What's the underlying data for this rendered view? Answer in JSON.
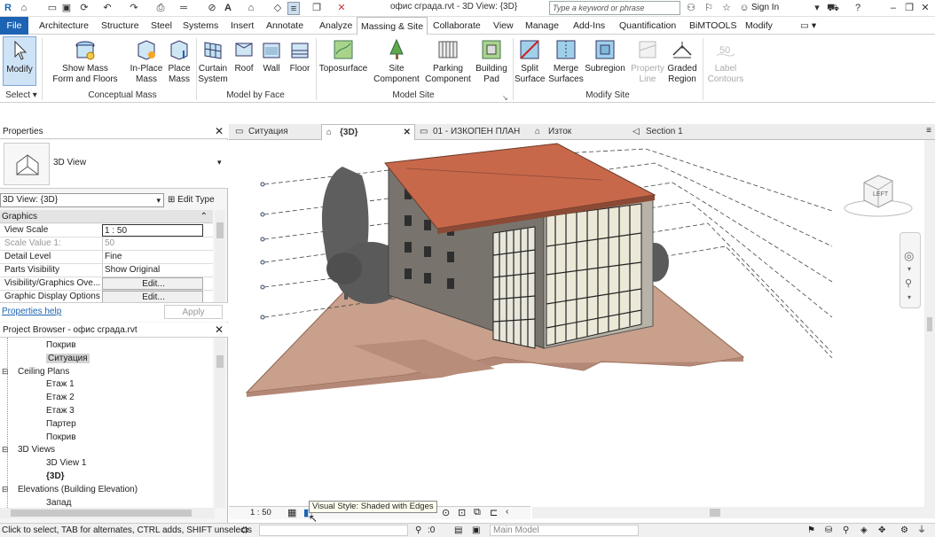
{
  "app": {
    "doc_title": "офис сграда.rvt - 3D View: {3D}",
    "search_placeholder": "Type a keyword or phrase",
    "sign_in": "Sign In"
  },
  "menu": {
    "tabs": [
      "File",
      "Architecture",
      "Structure",
      "Steel",
      "Systems",
      "Insert",
      "Annotate",
      "Analyze",
      "Massing & Site",
      "Collaborate",
      "View",
      "Manage",
      "Add-Ins",
      "Quantification",
      "BiMTOOLS",
      "Modify"
    ],
    "active": "Massing & Site"
  },
  "ribbon": {
    "modify": "Modify",
    "select_label": "Select",
    "show_mass_1": "Show Mass",
    "show_mass_2": "Form and Floors",
    "inplace_1": "In-Place",
    "inplace_2": "Mass",
    "place_1": "Place",
    "place_2": "Mass",
    "curtain_1": "Curtain",
    "curtain_2": "System",
    "roof": "Roof",
    "wall": "Wall",
    "floor": "Floor",
    "topo": "Toposurface",
    "site_comp_1": "Site",
    "site_comp_2": "Component",
    "parking_1": "Parking",
    "parking_2": "Component",
    "building_pad_1": "Building",
    "building_pad_2": "Pad",
    "split_1": "Split",
    "split_2": "Surface",
    "merge_1": "Merge",
    "merge_2": "Surfaces",
    "subregion": "Subregion",
    "property_line_1": "Property",
    "property_line_2": "Line",
    "graded_1": "Graded",
    "graded_2": "Region",
    "label_contours_1": "Label",
    "label_contours_2": "Contours",
    "group_conceptual": "Conceptual Mass",
    "group_model_face": "Model by Face",
    "group_model_site": "Model Site",
    "group_modify_site": "Modify Site"
  },
  "properties": {
    "title": "Properties",
    "type_name": "3D View",
    "selector": "3D View: {3D}",
    "edit_type": "Edit Type",
    "section": "Graphics",
    "rows": [
      {
        "k": "View Scale",
        "v": "1 : 50"
      },
      {
        "k": "Scale Value    1:",
        "v": "50"
      },
      {
        "k": "Detail Level",
        "v": "Fine"
      },
      {
        "k": "Parts Visibility",
        "v": "Show Original"
      },
      {
        "k": "Visibility/Graphics Ove...",
        "v": "Edit..."
      },
      {
        "k": "Graphic Display Options",
        "v": "Edit..."
      }
    ],
    "help": "Properties help",
    "apply": "Apply"
  },
  "browser": {
    "title": "Project Browser - офис сграда.rvt",
    "items": [
      {
        "text": "Покрив",
        "level": 3
      },
      {
        "text": "Ситуация",
        "level": 3,
        "selected": true
      },
      {
        "text": "Ceiling Plans",
        "level": 2,
        "toggle": "−"
      },
      {
        "text": "Етаж 1",
        "level": 3
      },
      {
        "text": "Етаж 2",
        "level": 3
      },
      {
        "text": "Етаж 3",
        "level": 3
      },
      {
        "text": "Партер",
        "level": 3
      },
      {
        "text": "Покрив",
        "level": 3
      },
      {
        "text": "3D Views",
        "level": 2,
        "toggle": "−"
      },
      {
        "text": "3D View 1",
        "level": 3
      },
      {
        "text": "{3D}",
        "level": 3,
        "bold": true
      },
      {
        "text": "Elevations (Building Elevation)",
        "level": 2,
        "toggle": "−"
      },
      {
        "text": "Запад",
        "level": 3
      }
    ]
  },
  "view_tabs": [
    {
      "label": "Ситуация"
    },
    {
      "label": "{3D}",
      "active": true
    },
    {
      "label": "01 - ИЗКОПЕН ПЛАН"
    },
    {
      "label": "Изток"
    },
    {
      "label": "Section 1"
    }
  ],
  "view_control": {
    "scale": "1 : 50",
    "tooltip": "Visual Style: Shaded with Edges"
  },
  "status": {
    "hint": "Click to select, TAB for alternates, CTRL adds, SHIFT unselects",
    "zero": ":0",
    "model": "Main Model"
  },
  "viewcube": {
    "face": "LEFT"
  },
  "colors": {
    "accent": "#1d63b3",
    "roof": "#c8684a",
    "wall": "#a39e95",
    "terrain": "#c9a08c"
  }
}
